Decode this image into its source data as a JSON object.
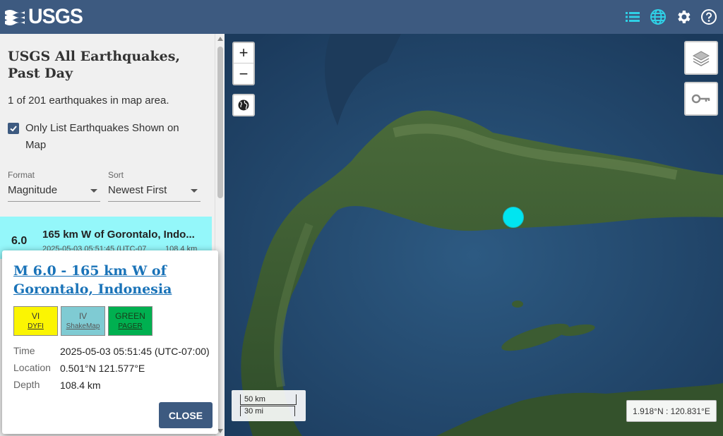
{
  "header": {
    "logo_text": "USGS",
    "icons": [
      "list-icon",
      "globe-icon",
      "gear-icon",
      "help-icon"
    ],
    "colors": {
      "bar": "#3d5a80",
      "active_icon": "#2fd0e6"
    }
  },
  "sidebar": {
    "title": "USGS All Earthquakes, Past Day",
    "count_text": "1 of 201 earthquakes in map area.",
    "only_list_label": "Only List Earthquakes Shown on Map",
    "only_list_checked": true,
    "format": {
      "label": "Format",
      "value": "Magnitude"
    },
    "sort": {
      "label": "Sort",
      "value": "Newest First"
    },
    "earthquakes": [
      {
        "magnitude": "6.0",
        "place": "165 km W of Gorontalo, Indo...",
        "time": "2025-05-03 05:51:45 (UTC-07",
        "depth": "108.4 km",
        "highlight_color": "#94f7fa"
      }
    ]
  },
  "map": {
    "zoom_in": "+",
    "zoom_out": "−",
    "scale_km": "50 km",
    "scale_mi": "30 mi",
    "coordinates": "1.918°N : 120.831°E",
    "marker_color": "#00e5f0"
  },
  "popup": {
    "title": "M 6.0 - 165 km W of Gorontalo, Indonesia",
    "badges": {
      "dyfi": {
        "value": "VI",
        "label": "DYFI",
        "color": "#fbf502"
      },
      "shakemap": {
        "value": "IV",
        "label": "ShakeMap",
        "color": "#7fcbd3"
      },
      "pager": {
        "value": "GREEN",
        "label": "PAGER",
        "color": "#00b050"
      }
    },
    "time_label": "Time",
    "time_value": "2025-05-03 05:51:45 (UTC-07:00)",
    "location_label": "Location",
    "location_value": "0.501°N 121.577°E",
    "depth_label": "Depth",
    "depth_value": "108.4 km",
    "close_label": "CLOSE"
  }
}
